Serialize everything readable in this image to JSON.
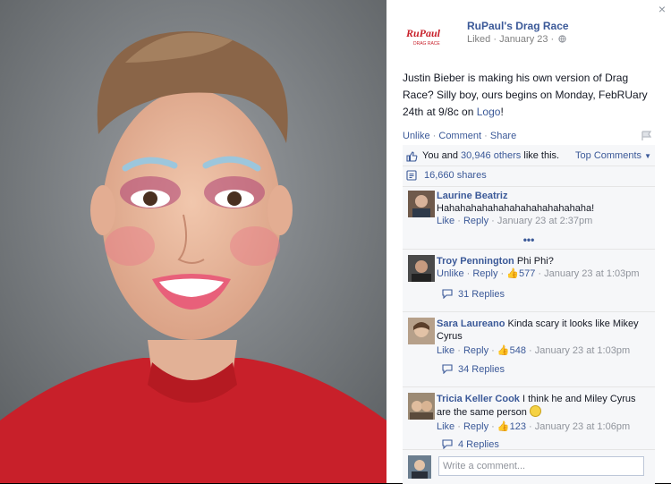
{
  "photo": {
    "description_icon": "mugshot-photo"
  },
  "header": {
    "page_name": "RuPaul's Drag Race",
    "meta": "Liked · January 23 ·",
    "logo_text": "RuPaul",
    "logo_subtext": "DRAG RACE"
  },
  "post": {
    "text_before_link": "Justin Bieber is making his own version of Drag Race? Silly boy, ours begins on Monday, FebRUary 24th at 9/8c on ",
    "link_text": "Logo",
    "text_after_link": "!"
  },
  "actions": {
    "unlike": "Unlike",
    "comment": "Comment",
    "share": "Share"
  },
  "likes": {
    "prefix": "You and ",
    "others_link": "30,946 others",
    "suffix": " like this.",
    "top_comments": "Top Comments"
  },
  "shares": {
    "label": "16,660 shares"
  },
  "comments": [
    {
      "author": "Laurine Beatriz",
      "text": "Hahahahahahahahahahahahahaha!",
      "like": "Like",
      "reply": "Reply",
      "likes_count": "",
      "time": "January 23 at 2:37pm",
      "action_label": "Like"
    },
    {
      "author": "Troy Pennington",
      "text": "Phi Phi?",
      "like": "Unlike",
      "reply": "Reply",
      "likes_count": "577",
      "time": "January 23 at 1:03pm",
      "replies": "31 Replies"
    },
    {
      "author": "Sara Laureano",
      "text": "Kinda scary it looks like Mikey Cyrus",
      "like": "Like",
      "reply": "Reply",
      "likes_count": "548",
      "time": "January 23 at 1:03pm",
      "replies": "34 Replies"
    },
    {
      "author": "Tricia Keller Cook",
      "text": "I think he and Miley Cyrus are the same person",
      "like": "Like",
      "reply": "Reply",
      "likes_count": "123",
      "time": "January 23 at 1:06pm",
      "replies": "4 Replies"
    }
  ],
  "more": {
    "label": "•••"
  },
  "composer": {
    "placeholder": "Write a comment..."
  },
  "close": {
    "label": "×"
  },
  "colors": {
    "link": "#3b5998",
    "muted": "#90949c",
    "ufi_bg": "#f6f7f9"
  }
}
